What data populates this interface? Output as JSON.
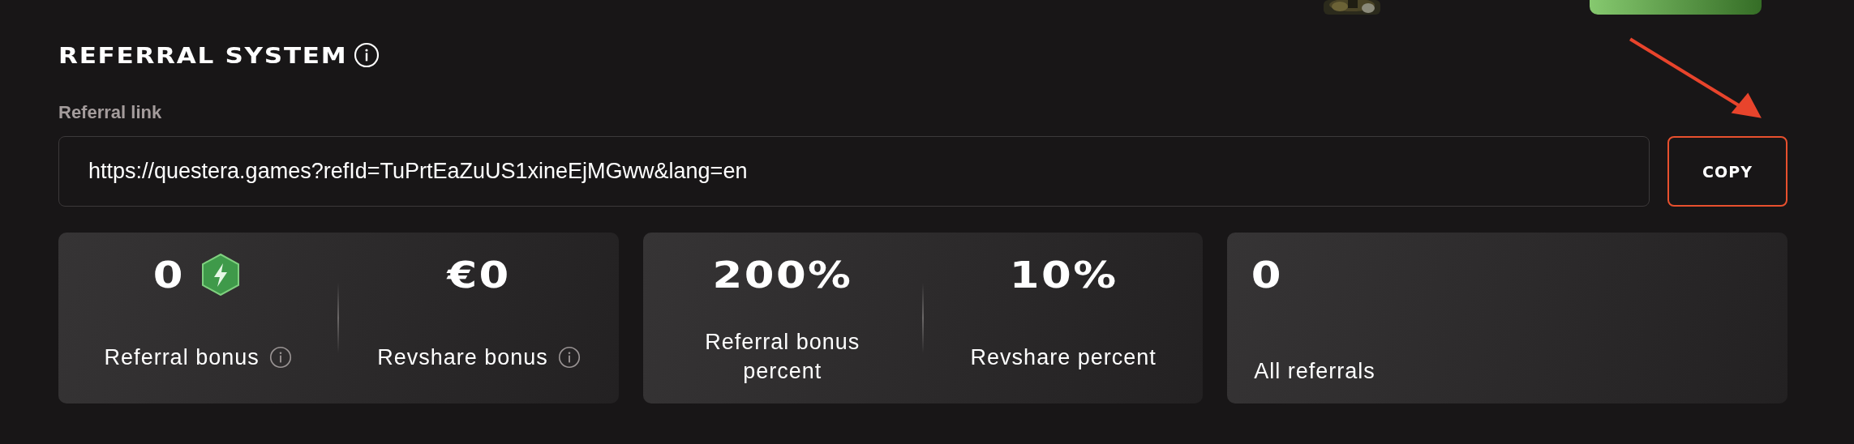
{
  "header": {
    "title": "REFERRAL SYSTEM"
  },
  "referral_link": {
    "label": "Referral link",
    "value": "https://questera.games?refId=TuPrtEaZuUS1xineEjMGww&lang=en",
    "button": "COPY"
  },
  "cards": [
    {
      "kind": "split",
      "stats": [
        {
          "kind": "points",
          "value": "0",
          "label": "Referral bonus"
        },
        {
          "kind": "amount",
          "value": "€0",
          "label": "Revshare bonus"
        }
      ]
    },
    {
      "kind": "split",
      "stats": [
        {
          "kind": "plain",
          "value": "200%",
          "label": "Referral bonus percent"
        },
        {
          "kind": "plain",
          "value": "10%",
          "label": "Revshare percent"
        }
      ]
    },
    {
      "kind": "single",
      "stats": [
        {
          "kind": "plain",
          "value": "0",
          "label": "All referrals"
        }
      ]
    }
  ]
}
